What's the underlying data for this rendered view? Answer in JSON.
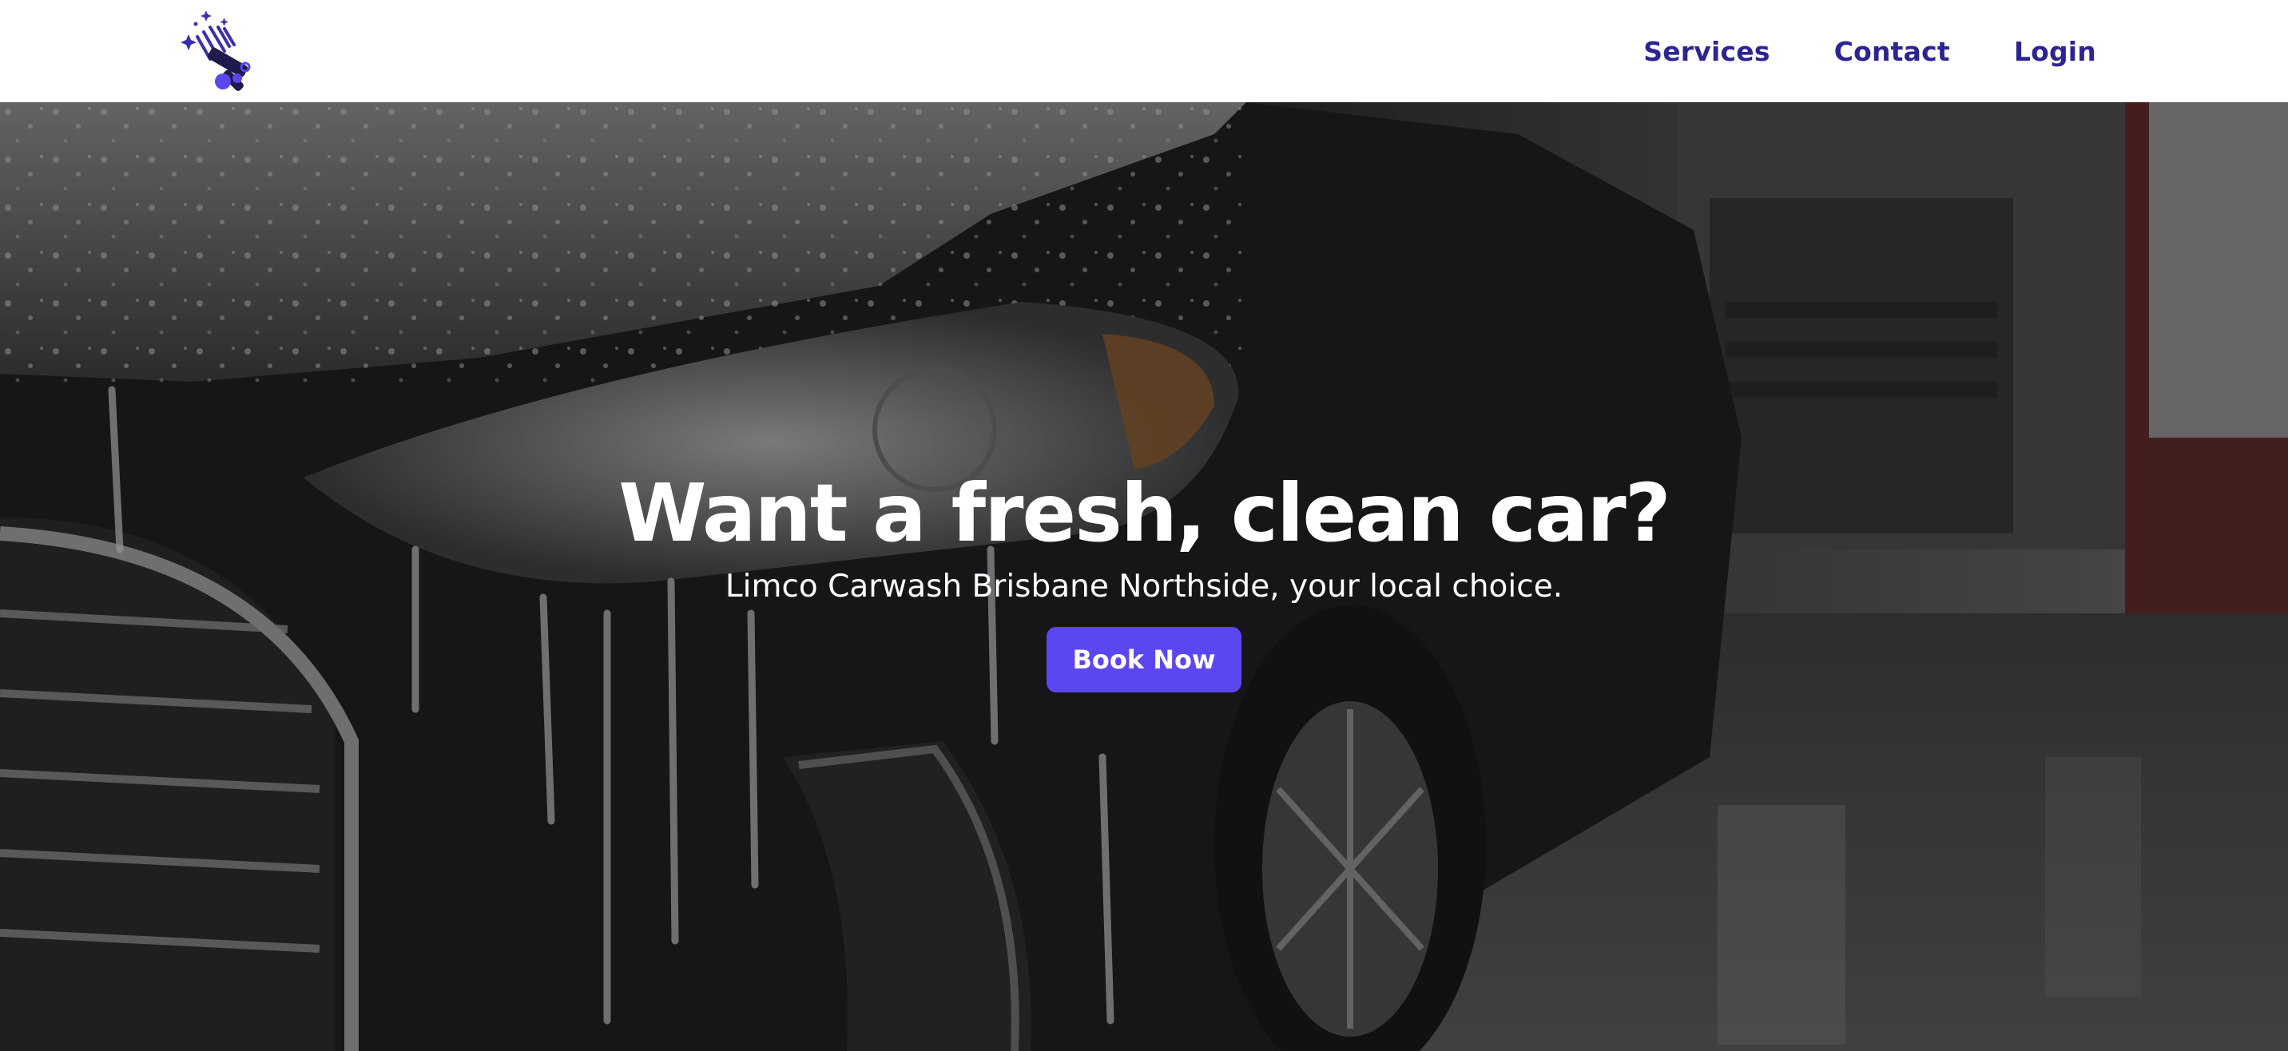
{
  "brand": {
    "logo_icon": "squeegee-sparkle-icon",
    "accent_color": "#2d2494",
    "button_color": "#5b47ef"
  },
  "nav": {
    "items": [
      {
        "label": "Services"
      },
      {
        "label": "Contact"
      },
      {
        "label": "Login"
      }
    ]
  },
  "hero": {
    "background": "foamy-black-car-photo",
    "title": "Want a fresh, clean car?",
    "subtitle": "Limco Carwash Brisbane Northside, your local choice.",
    "cta_label": "Book Now"
  }
}
